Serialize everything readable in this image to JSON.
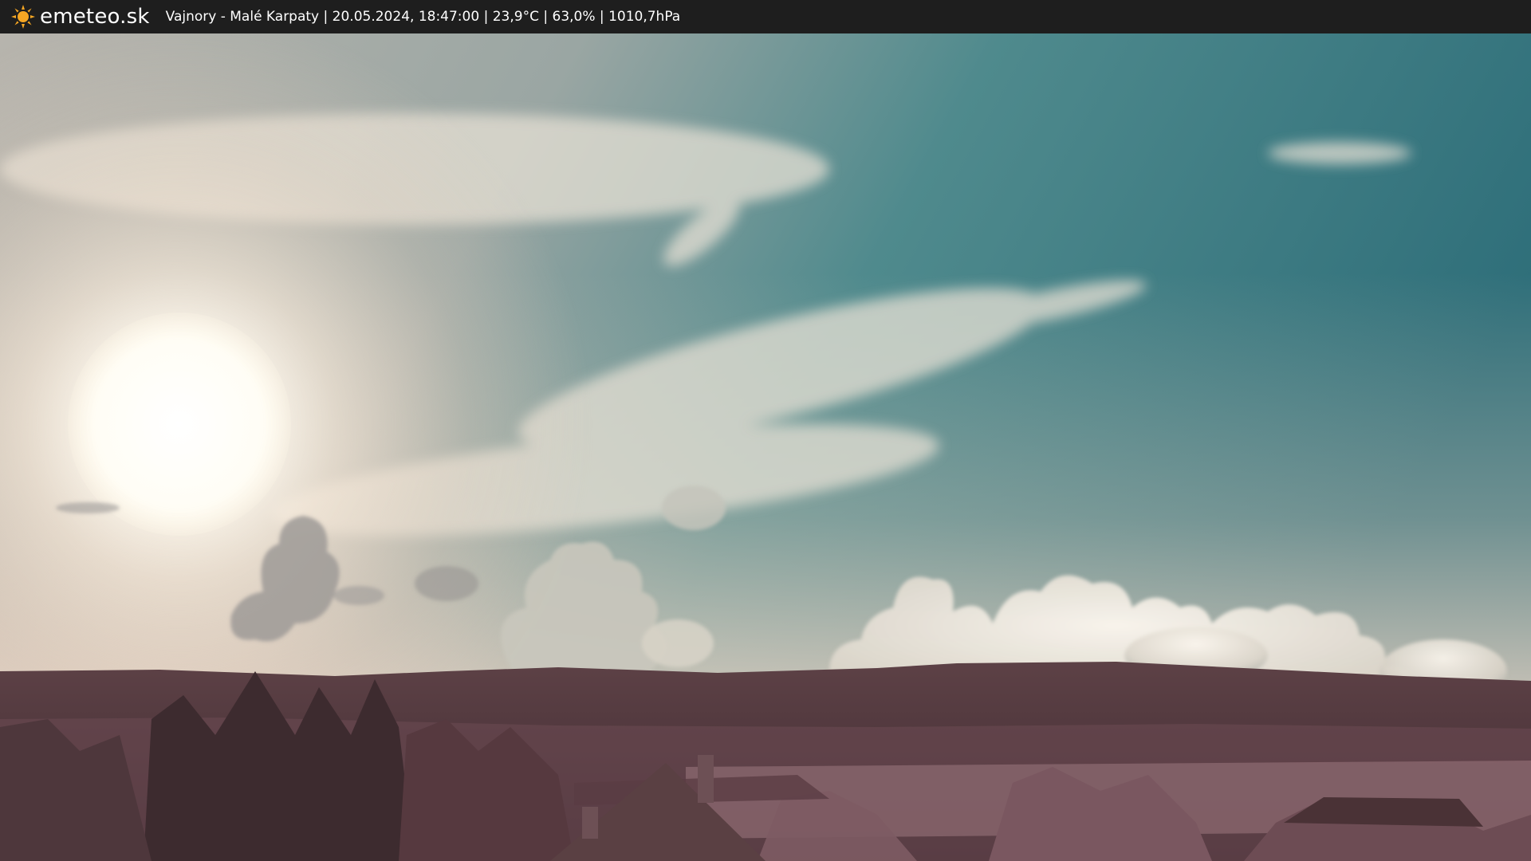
{
  "header": {
    "logo_text": "emeteo.sk",
    "logo_icon": "sun-icon",
    "location": "Vajnory - Malé Karpaty",
    "datetime": "20.05.2024, 18:47:00",
    "temperature": "23,9°C",
    "humidity": "63,0%",
    "pressure": "1010,7hPa",
    "separator": " | "
  },
  "colors": {
    "bar_background": "#1e1e1e",
    "logo_sun": "#f5a623",
    "sky_teal": "#3f7f86",
    "sky_warm": "#e9d6c4",
    "hills": "#5a3f43",
    "foliage": "#7a5560"
  }
}
